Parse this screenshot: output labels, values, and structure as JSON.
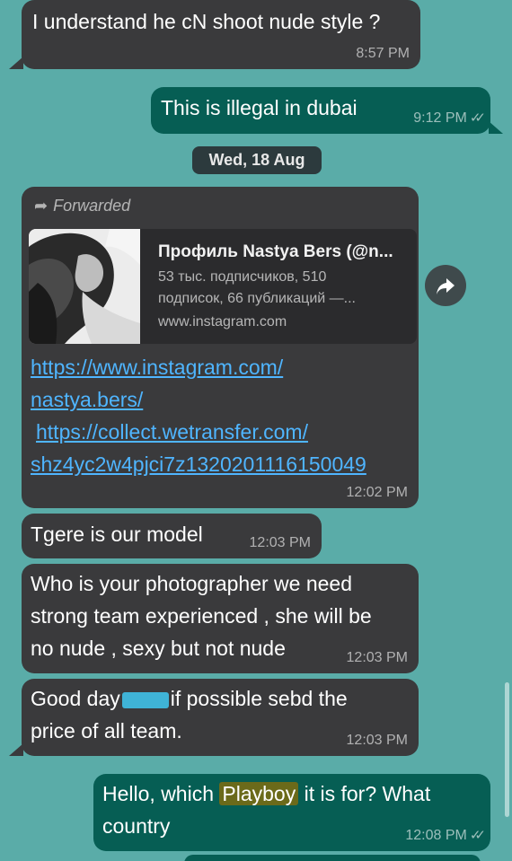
{
  "messages": {
    "m1": {
      "text": "I understand he cN shoot nude style ?",
      "time": "8:57 PM"
    },
    "m2": {
      "text": "This is illegal in dubai",
      "time": "9:12 PM"
    },
    "date_separator": "Wed, 18 Aug",
    "m3": {
      "forwarded_label": "Forwarded",
      "preview_title": "Профиль Nastya Bers (@n...",
      "preview_desc_line1": "53 тыс. подписчиков, 510",
      "preview_desc_line2": "подписок, 66 публикаций —...",
      "preview_domain": "www.instagram.com",
      "link1_line1": "https://www.instagram.com/",
      "link1_line2": "nastya.bers/",
      "link2_line1": "https://collect.wetransfer.com/",
      "link2_line2": "shz4yc2w4pjci7z1320201116150049",
      "time": "12:02 PM"
    },
    "m4": {
      "text": "Tgere is our model",
      "time": "12:03 PM"
    },
    "m5": {
      "line1": "Who is your photographer we need",
      "line2": "strong team experienced , she will be",
      "line3": "no nude , sexy but not nude",
      "time": "12:03 PM"
    },
    "m6": {
      "part1": "Good day",
      "part2": "if possible sebd the",
      "line2": "price of all team.",
      "time": "12:03 PM"
    },
    "m7": {
      "part1": "Hello, which ",
      "highlight": "Playboy",
      "part2": " it is for? What",
      "line2": "country",
      "time": "12:08 PM"
    }
  },
  "icons": {
    "read_ticks": "double-check-icon",
    "forward": "forward-arrow-icon"
  },
  "colors": {
    "background": "#5aaca8",
    "incoming": "#3a3a3c",
    "outgoing": "#065e54",
    "link": "#4fb5ff",
    "redaction": "#3fb3d6",
    "highlight": "#6b6a1a"
  }
}
